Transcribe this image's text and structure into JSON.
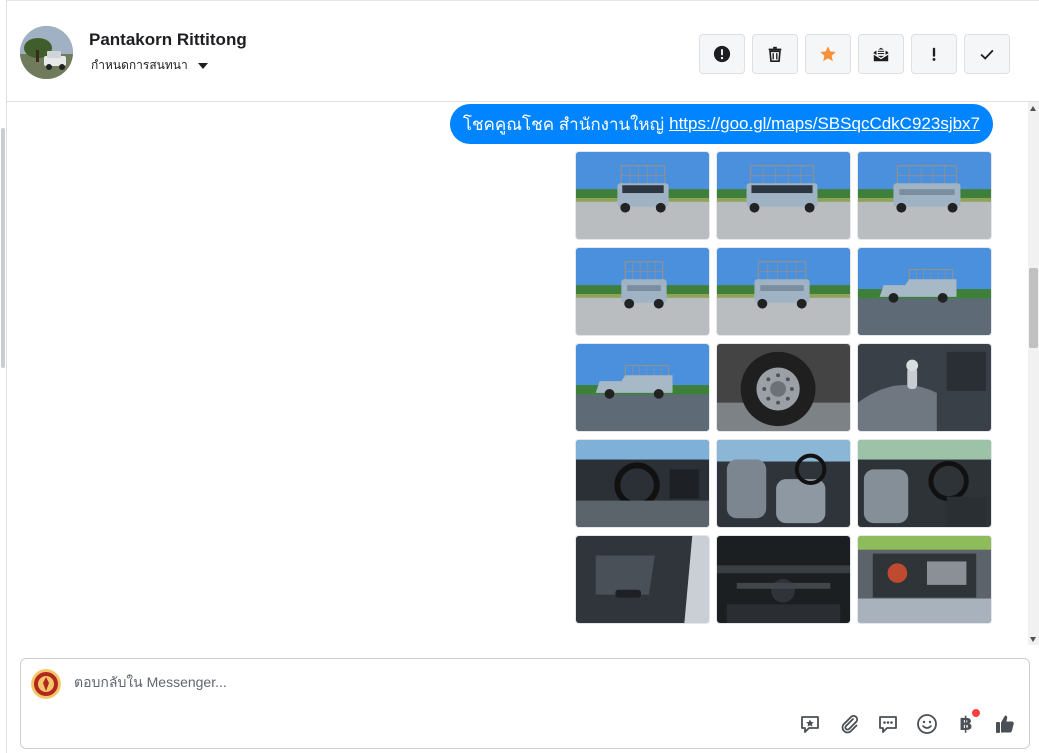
{
  "contact": {
    "name": "Pantakorn Rittitong",
    "assign_label": "กำหนดการสนทนา"
  },
  "header_actions": [
    {
      "icon": "alert-circle-icon",
      "name": "mark-spam-button"
    },
    {
      "icon": "trash-icon",
      "name": "delete-button"
    },
    {
      "icon": "star-icon",
      "name": "star-button",
      "color": "#f7923b"
    },
    {
      "icon": "mail-unread-icon",
      "name": "mark-unread-button"
    },
    {
      "icon": "exclamation-icon",
      "name": "follow-up-button"
    },
    {
      "icon": "checkmark-icon",
      "name": "mark-done-button"
    }
  ],
  "message": {
    "text": "โชคคูณโชค สำนักงานใหญ่",
    "link": "https://goo.gl/maps/SBSqcCdkC923sjbx7",
    "bubble_color": "#0084ff"
  },
  "photos": [
    {
      "scene": "truck-front"
    },
    {
      "scene": "truck-front-angle"
    },
    {
      "scene": "truck-rear-angle"
    },
    {
      "scene": "truck-rear"
    },
    {
      "scene": "truck-rear-left"
    },
    {
      "scene": "truck-side-right"
    },
    {
      "scene": "truck-side-left"
    },
    {
      "scene": "wheel"
    },
    {
      "scene": "interior-gearshift"
    },
    {
      "scene": "interior-dashboard"
    },
    {
      "scene": "interior-seats"
    },
    {
      "scene": "interior-cabin"
    },
    {
      "scene": "door-panel"
    },
    {
      "scene": "underbody"
    },
    {
      "scene": "engine-bay"
    }
  ],
  "composer": {
    "placeholder": "ตอบกลับใน Messenger...",
    "tools": [
      "saved-reply-icon",
      "attachment-icon",
      "quick-reply-icon",
      "emoji-icon",
      "baht-icon",
      "like-icon"
    ],
    "baht_symbol": "฿",
    "notification_dot_color": "#fa3e3e"
  }
}
